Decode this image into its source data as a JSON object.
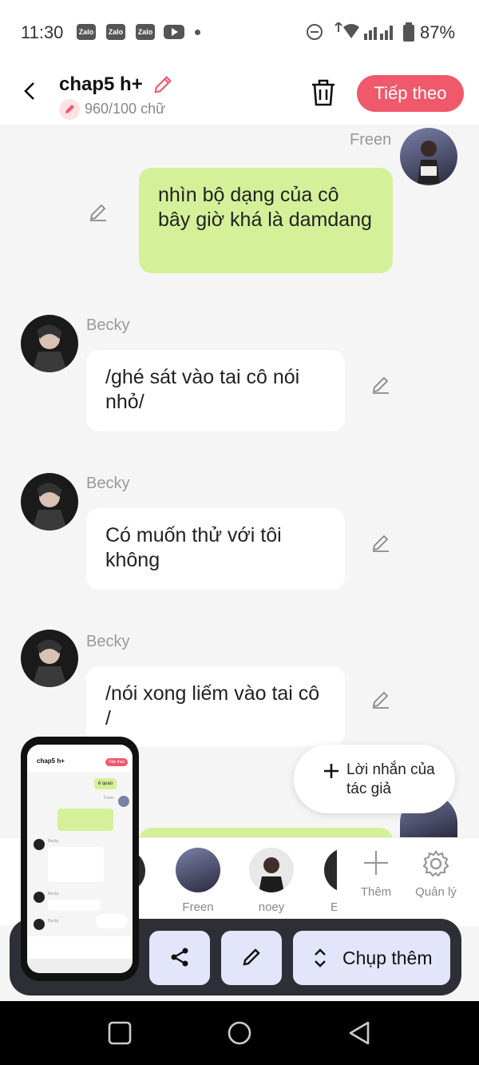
{
  "status_bar": {
    "time": "11:30",
    "apps": [
      "Zalo",
      "Zalo",
      "Zalo"
    ],
    "battery": "87%"
  },
  "header": {
    "title": "chap5 h+",
    "word_count": "960/100 chữ",
    "next_label": "Tiếp theo"
  },
  "messages": [
    {
      "sender": "Freen",
      "side": "right",
      "text": "nhìn bộ dạng của cô bây giờ khá là damdang",
      "style": "green"
    },
    {
      "sender": "Becky",
      "side": "left",
      "text": "/ghé sát vào tai cô nói nhỏ/",
      "style": "white"
    },
    {
      "sender": "Becky",
      "side": "left",
      "text": "Có muốn thử với tôi không",
      "style": "white"
    },
    {
      "sender": "Becky",
      "side": "left",
      "text": "/nói xong liếm vào tai cô /",
      "style": "white"
    }
  ],
  "author_note": {
    "label": "Lời nhắn của tác giả"
  },
  "characters": [
    {
      "name": "Freen"
    },
    {
      "name": "noey"
    },
    {
      "name": "E"
    }
  ],
  "char_actions": {
    "add": "Thêm",
    "manage": "Quản lý"
  },
  "toolbar": {
    "capture_label": "Chụp thêm"
  },
  "thumbnail": {
    "title": "chap5 h+",
    "next": "Tiếp theo",
    "greeting": "ê quao",
    "names": [
      "Freen",
      "Becky",
      "Becky",
      "Becky"
    ]
  },
  "colors": {
    "accent": "#f0586b",
    "green_bubble": "#d4f19a",
    "toolbar_bg": "#2e2e36",
    "tool_btn": "#e3e5fb"
  }
}
